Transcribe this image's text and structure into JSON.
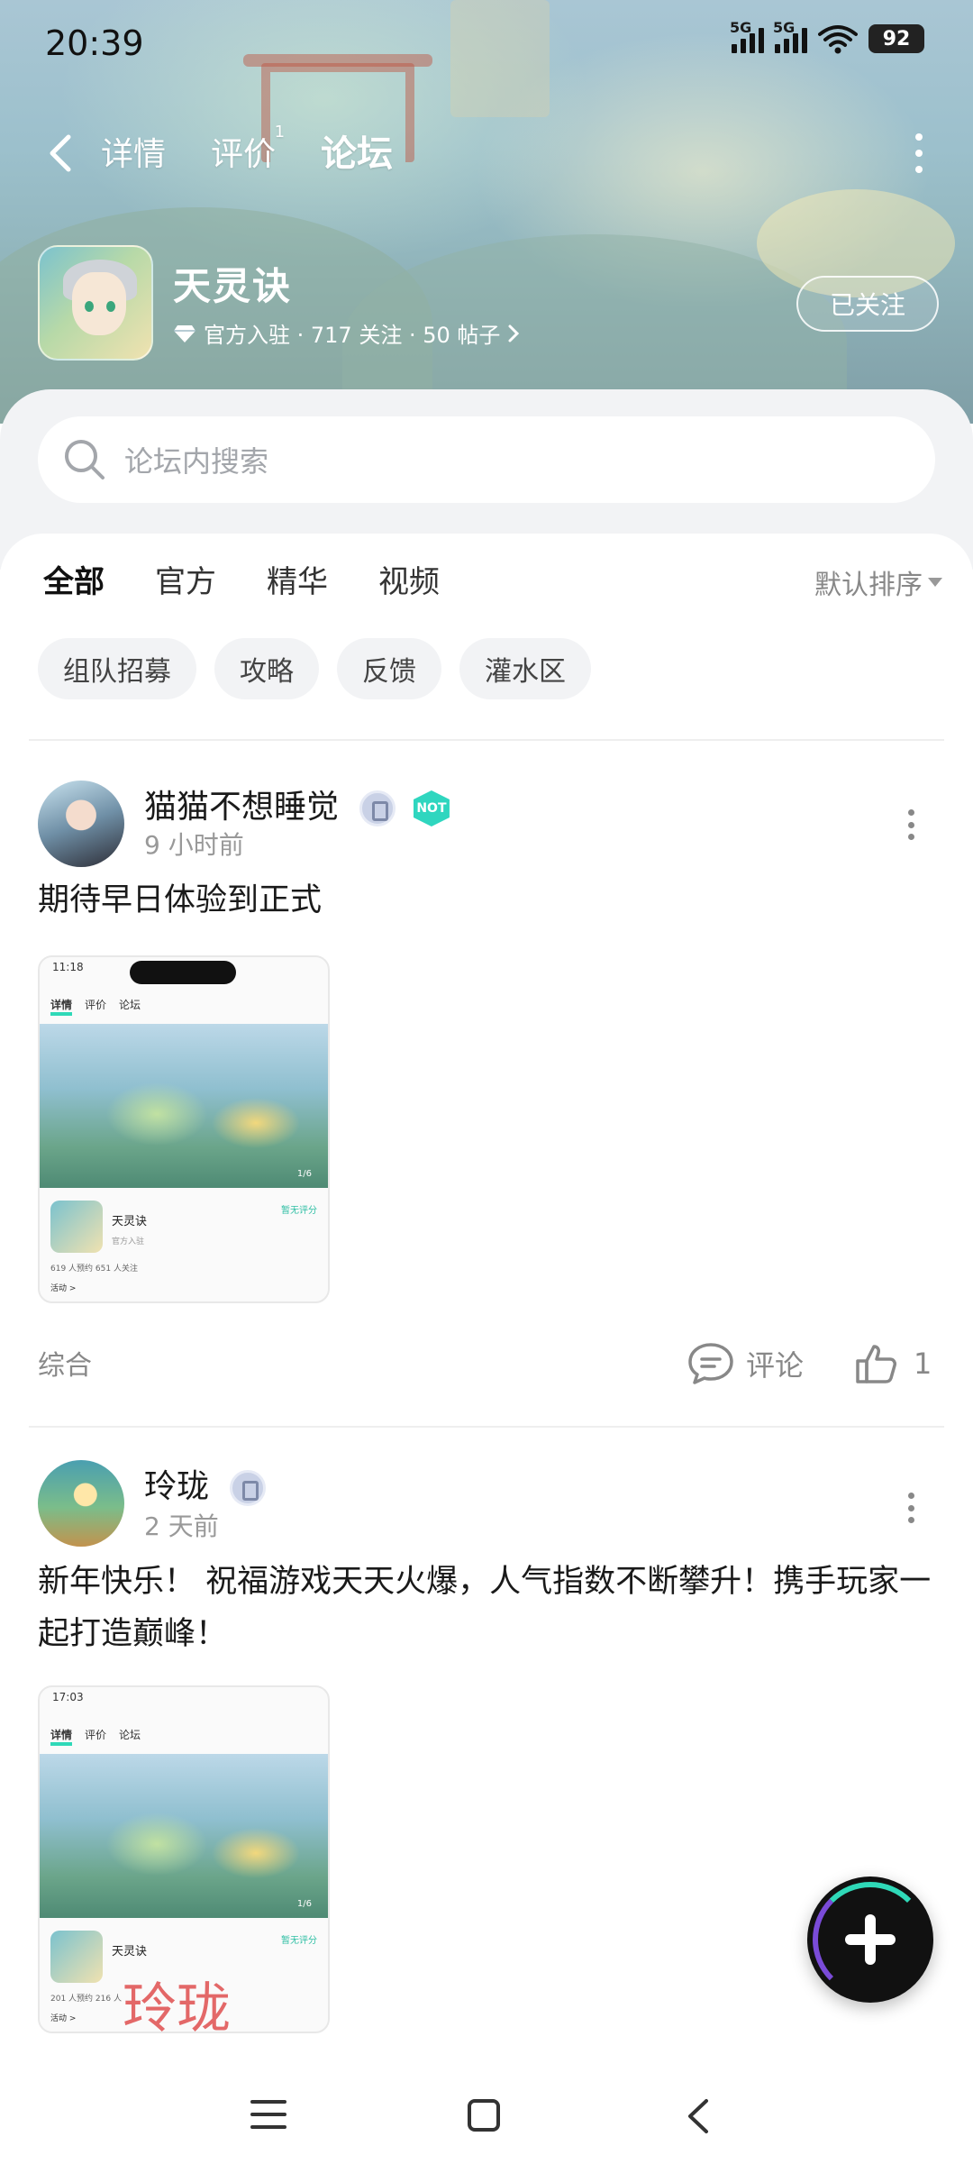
{
  "status_bar": {
    "time": "20:39",
    "sim1_label": "5G",
    "sim2_label": "5G",
    "battery": "92"
  },
  "nav": {
    "tabs": [
      {
        "label": "详情",
        "badge": ""
      },
      {
        "label": "评价",
        "badge": "1"
      },
      {
        "label": "论坛",
        "badge": ""
      }
    ],
    "active_tab": "论坛"
  },
  "app": {
    "name": "天灵诀",
    "meta": "官方入驻 · 717 关注 · 50 帖子",
    "follow_label": "已关注"
  },
  "search": {
    "placeholder": "论坛内搜索"
  },
  "filters": {
    "tabs": [
      "全部",
      "官方",
      "精华",
      "视频"
    ],
    "active": "全部",
    "sort_label": "默认排序"
  },
  "chips": [
    "组队招募",
    "攻略",
    "反馈",
    "灌水区"
  ],
  "posts": [
    {
      "username": "猫猫不想睡觉",
      "time": "9 小时前",
      "text": "期待早日体验到正式",
      "badge_hex_text": "NOT",
      "thumb": {
        "status_time": "11:18",
        "tabs": [
          "详情",
          "评价",
          "论坛"
        ],
        "app_name": "天灵诀",
        "sub": "官方入驻",
        "score": "暂无评分",
        "counts": "619 人预约   651 人关注",
        "activity": "活动 >",
        "page": "1/6"
      },
      "tag": "综合",
      "comment_label": "评论",
      "likes": "1"
    },
    {
      "username": "玲珑",
      "time": "2 天前",
      "text": "新年快乐！ 祝福游戏天天火爆，人气指数不断攀升！携手玩家一起打造巅峰！",
      "thumb": {
        "status_time": "17:03",
        "tabs": [
          "详情",
          "评价",
          "论坛"
        ],
        "app_name": "天灵诀",
        "score": "暂无评分",
        "counts": "201 人预约   216 人",
        "activity": "活动 >",
        "page": "1/6",
        "watermark": "玲珑"
      }
    }
  ],
  "colors": {
    "accent": "#2fd9b8",
    "text_secondary": "#999999",
    "chip_bg": "#f2f3f5"
  }
}
